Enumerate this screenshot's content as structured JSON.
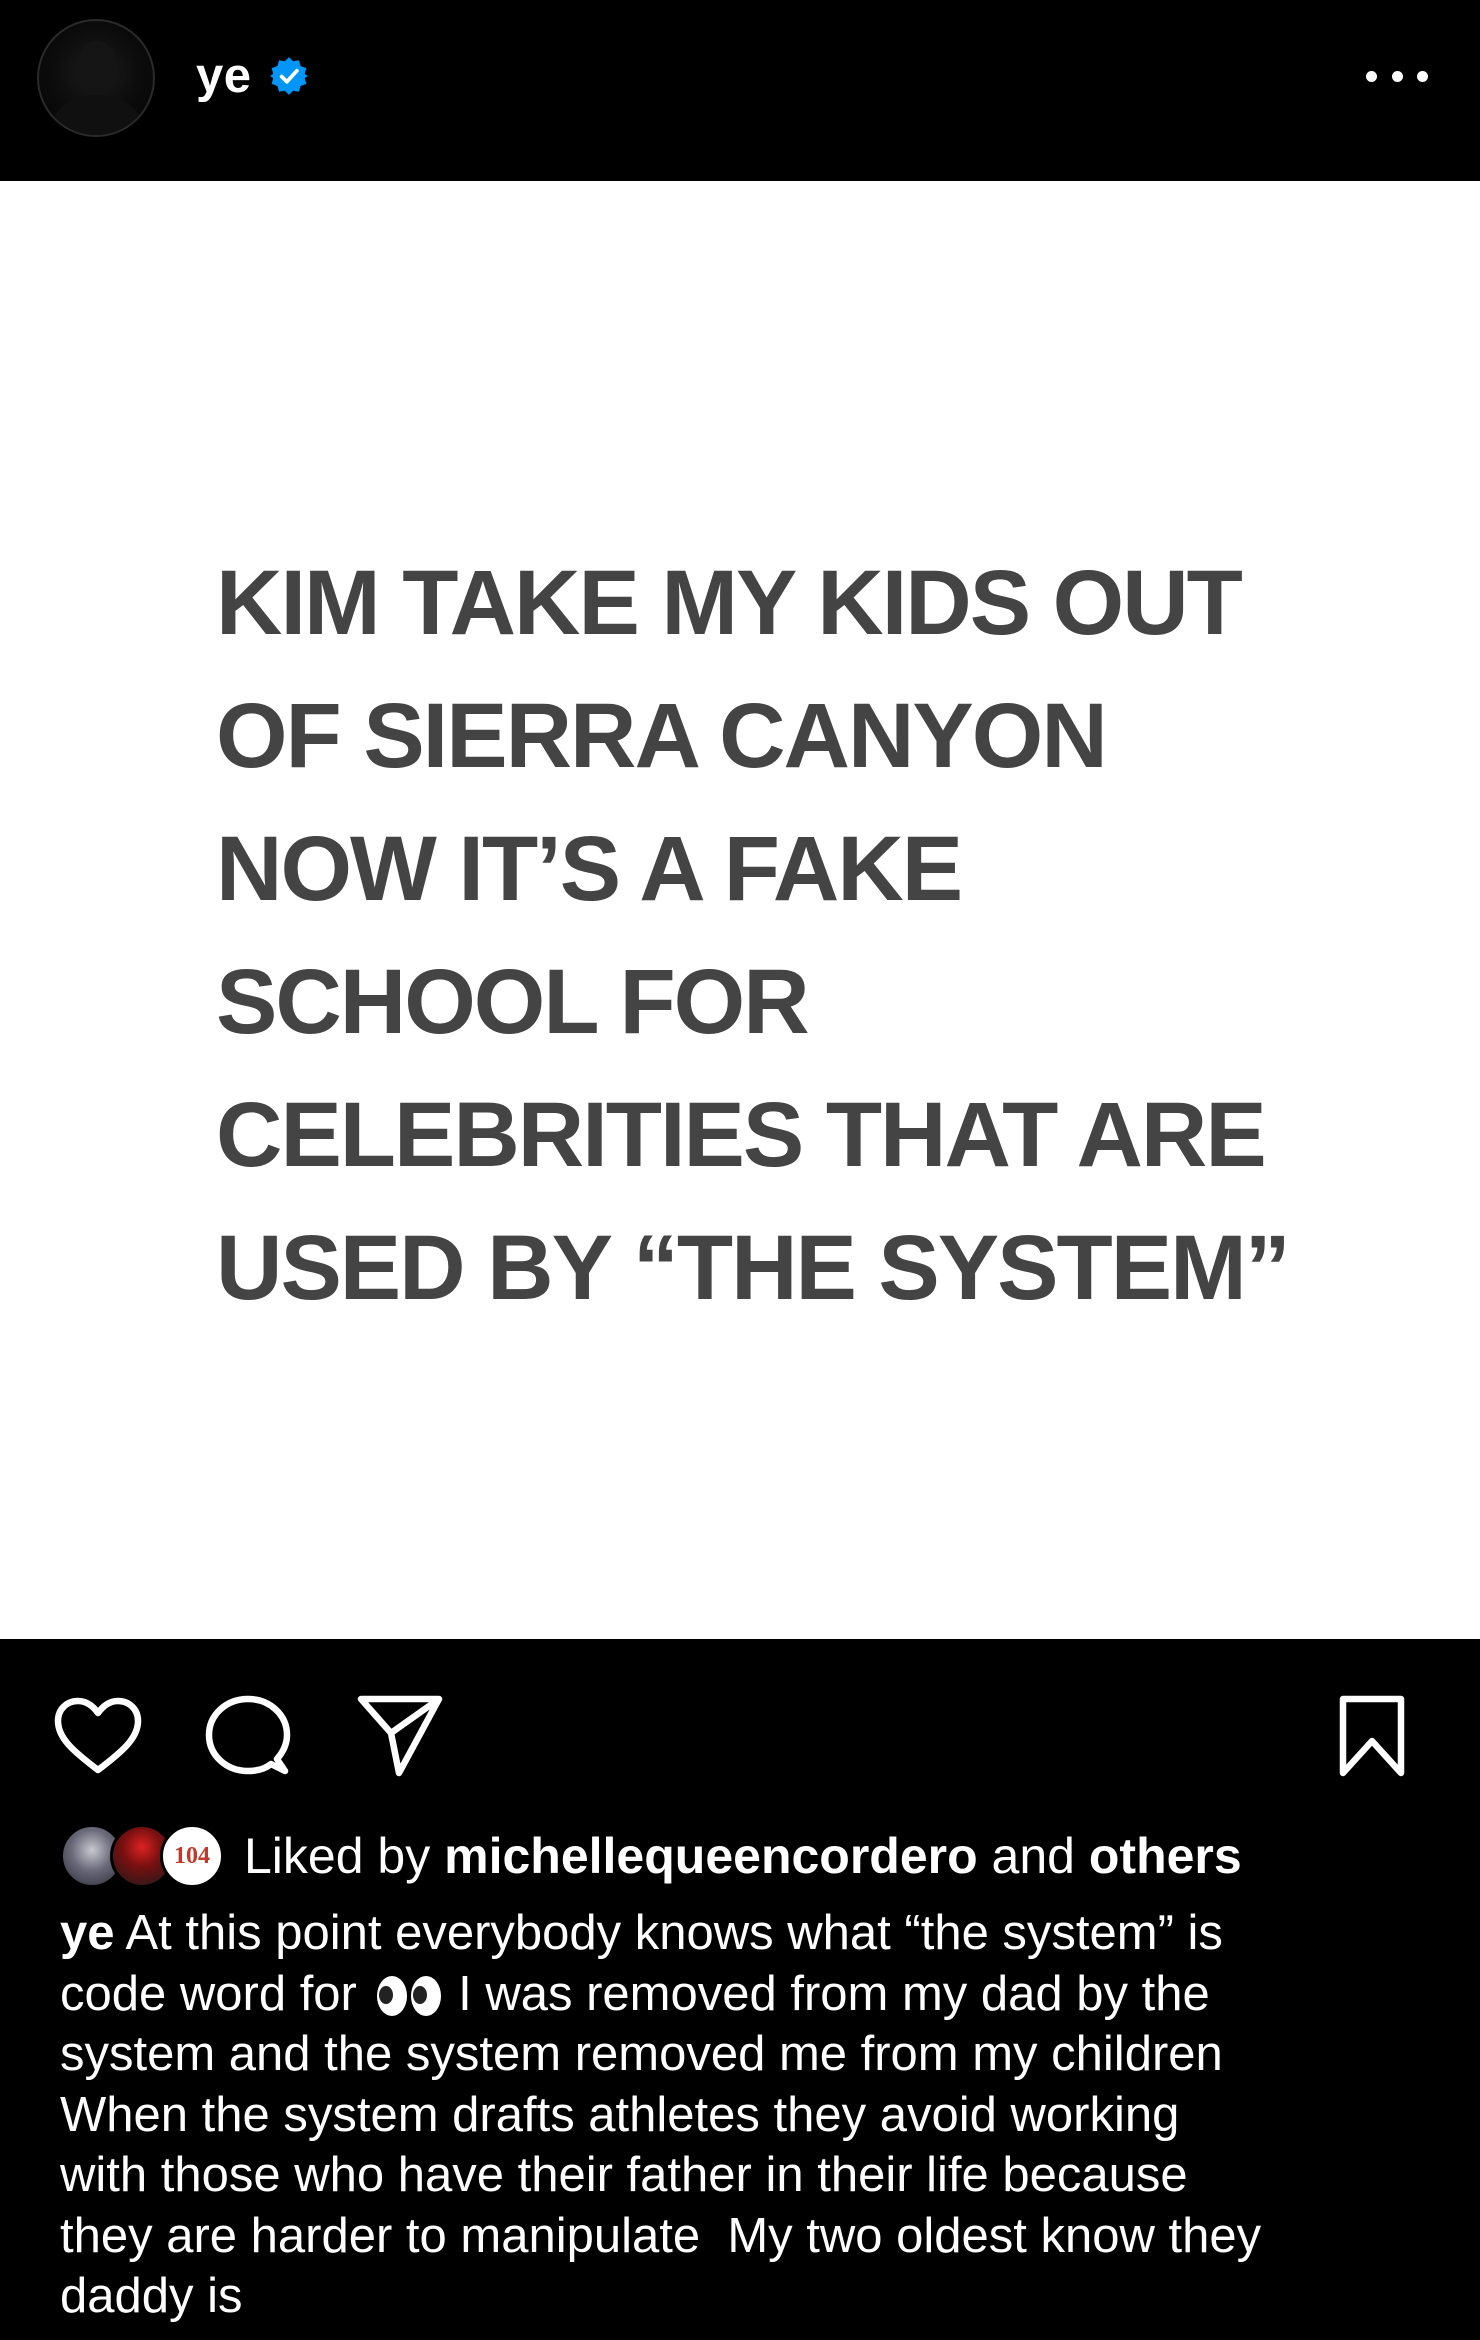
{
  "header": {
    "username": "ye",
    "verified": true,
    "more_icon": "more-horizontal-icon",
    "avatar_icon": "profile-avatar"
  },
  "post": {
    "image_text": "KIM TAKE MY KIDS OUT\nOF SIERRA CANYON\nNOW    IT’S A FAKE\nSCHOOL FOR\nCELEBRITIES THAT ARE\nUSED BY “THE SYSTEM”",
    "image_background": "#ffffff",
    "image_text_color": "#444444"
  },
  "actions": {
    "like_icon": "heart-icon",
    "comment_icon": "comment-bubble-icon",
    "share_icon": "paper-plane-icon",
    "save_icon": "bookmark-icon"
  },
  "likes": {
    "prefix": "Liked by",
    "user": "michellequeencordero",
    "conjunction": "and",
    "suffix": "others",
    "badge_text": "104"
  },
  "caption": {
    "username": "ye",
    "line1": "At this point everybody knows what “the system” is",
    "line2_a": "code word for",
    "line2_b": "I was removed from my dad by the",
    "line3": "system and the system removed me from my children",
    "line4": "When the system drafts athletes they avoid working",
    "line5": "with those who have their father in their life because",
    "line6": "they are harder to manipulate  My two oldest know they",
    "line7": "daddy is",
    "emoji": "eyes-emoji"
  },
  "colors": {
    "background": "#000000",
    "text": "#ffffff",
    "verified_badge": "#0095f6"
  }
}
